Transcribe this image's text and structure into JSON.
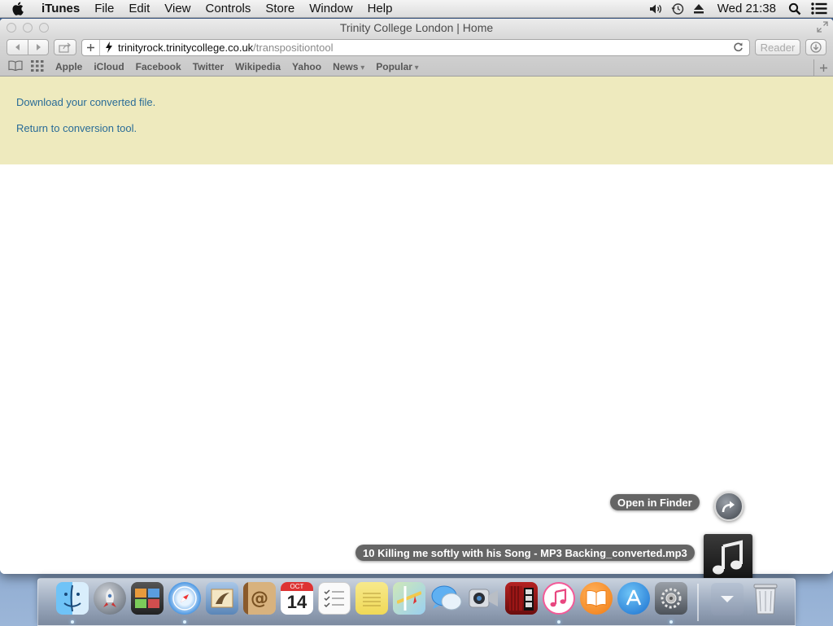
{
  "menubar": {
    "app_name": "iTunes",
    "items": [
      "File",
      "Edit",
      "View",
      "Controls",
      "Store",
      "Window",
      "Help"
    ],
    "clock": "Wed 21:38",
    "status_icons": [
      "volume-icon",
      "time-machine-icon",
      "eject-icon",
      "spotlight-icon",
      "notification-center-icon"
    ]
  },
  "window": {
    "title": "Trinity College London | Home",
    "address": {
      "host": "trinityrock.trinitycollege.co.uk",
      "path": "/transpositiontool"
    },
    "reader_label": "Reader",
    "bookmarks": [
      {
        "label": "Apple",
        "dropdown": false
      },
      {
        "label": "iCloud",
        "dropdown": false
      },
      {
        "label": "Facebook",
        "dropdown": false
      },
      {
        "label": "Twitter",
        "dropdown": false
      },
      {
        "label": "Wikipedia",
        "dropdown": false
      },
      {
        "label": "Yahoo",
        "dropdown": false
      },
      {
        "label": "News",
        "dropdown": true
      },
      {
        "label": "Popular",
        "dropdown": true
      }
    ]
  },
  "page": {
    "banner_color": "#eeeabe",
    "link_color": "#2a6c97",
    "download_link": "Download your converted file.",
    "return_link": "Return to conversion tool."
  },
  "download_stack": {
    "open_in_finder_label": "Open in Finder",
    "file_name": "10 Killing me softly with his Song - MP3 Backing_converted.mp3"
  },
  "dock": {
    "apps": [
      "Finder",
      "Launchpad",
      "Photo Booth",
      "Safari",
      "Mail",
      "Contacts",
      "Calendar",
      "Reminders",
      "Notes",
      "Maps",
      "Messages",
      "FaceTime",
      "Photo Booth",
      "iTunes",
      "iBooks",
      "App Store",
      "System Preferences"
    ],
    "calendar_day": "14",
    "calendar_month": "OCT"
  }
}
